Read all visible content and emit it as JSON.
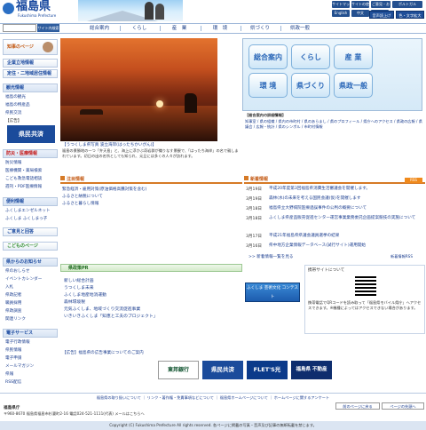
{
  "header": {
    "logo_text": "福島県",
    "logo_sub": "Fukushima Prefecture",
    "util_links": [
      "サイトマップ",
      "サイトの使い方",
      "ご意見・お問合せ",
      "English",
      "中文",
      "한국어",
      "ポルトガル"
    ],
    "accessibility": [
      "音声読上げ",
      "色・文字拡大"
    ]
  },
  "nav": {
    "search_placeholder": "",
    "search_button": "サイト内検索",
    "items": [
      "総合案内",
      "くらし",
      "産　業",
      "環　境",
      "県づくり",
      "県政一般"
    ]
  },
  "sidebar": {
    "governor_label": "知事のページ",
    "sections": [
      {
        "label": "企業立地情報"
      },
      {
        "label": "定住・二地域居住情報"
      }
    ],
    "tourism": {
      "title": "観光情報",
      "items": [
        "福島の観光",
        "福島の特産品",
        "県民交流"
      ]
    },
    "ad_label": "【広告】",
    "ad_banner": "県民共済",
    "disaster": {
      "title": "防災・医療情報",
      "items": [
        "防災情報",
        "医療機関・薬局検索",
        "こども救急電話相談",
        "週刊・PDF医療情報"
      ]
    },
    "useful": {
      "title": "便利情報",
      "items": [
        "ふくしまエンゼルネット",
        "ふくしま ふくしまっ子"
      ]
    },
    "opinion": "ご意見と回答",
    "kids": "こどものページ",
    "notice": {
      "title": "県からのお知らせ",
      "items": [
        "県のおしらせ",
        "イベントカレンダー",
        "入札",
        "県政記者",
        "職員採用",
        "県政調査",
        "関連リンク"
      ]
    },
    "eservice": {
      "title": "電子サービス",
      "items": [
        "電子行政情報",
        "県民情報",
        "電子申請",
        "メールマガジン",
        "県報",
        "RSS配信"
      ]
    }
  },
  "hero": {
    "caption": "【うつくしま県写真 波立海岸(はったちかいがん)】",
    "desc": "福島の景勝地の一つ「弁天島」と、海上に浮かぶ奇岩群が織りなす景観で、「はったち海岸」の名で親しまれています。初日の出の名所としても知られ、元旦には多くの人々が訪れます。"
  },
  "tiles": [
    "総合案内",
    "くらし",
    "産 業",
    "環 境",
    "県づくり",
    "県政一般"
  ],
  "links": {
    "title": "【総合案内の詳細情報】",
    "text": "知事室 / 県の組織 / 県内の市町村 / 県のあらまし / 県のプロフィール / 県庁へのアクセス / 県政の広報 / 県議会 / 広報・統計 / 県のシンボル / 市町村情報"
  },
  "notice": {
    "title": "注目情報",
    "items": [
      "緊急経済・雇用対策(原油価格高騰対策を含む)",
      "ふるさと納税について",
      "ふるさと暮らし情報"
    ]
  },
  "news": {
    "title": "新着情報",
    "rss": "RSS",
    "items": [
      {
        "date": "3月19日",
        "text": "平成20年度第3回福島県消費生活審議会を開催します。"
      },
      {
        "date": "3月19日",
        "text": "森林(水)の未来を考える国民会議(仮)を開催します"
      },
      {
        "date": "3月18日",
        "text": "福島県立大野病院医療過誤事件の公判の概要について"
      },
      {
        "date": "3月18日",
        "text": "ふくしま県産品販売促進センター運営事業業務委託企画提案競技の実施について"
      },
      {
        "date": "3月17日",
        "text": "平成21年福島県県議会議員選挙の結果"
      },
      {
        "date": "3月16日",
        "text": "県中地方企業情報データベース(試行サイト)運用開始"
      }
    ],
    "more": ">> 新着情報一覧を見る",
    "rss_label": "新着情報RSS"
  },
  "pr": {
    "title": "県政策PR",
    "items": [
      "新しい総合計画",
      "うつくしま未来",
      "ふくしま地産地消運動",
      "森林環境税",
      "元気ふくしま、地域づくり交流促進事業",
      "いきいきふくしま「知恵と工夫のプロジェクト」"
    ],
    "banner": "ふくしま 芸術文化 コンテスト"
  },
  "mobile": {
    "title": "携帯サイトについて",
    "desc": "携帯電話でQRコードを読み取って「福島県モバイル県庁」へアクセスできます。※機種によってはアクセスできない場合があります。"
  },
  "ads": {
    "label": "【広告】福島県の広告事業についてのご案内",
    "banners": [
      "東邦銀行",
      "県民共済",
      "FLET'S光",
      "福島県 不動産"
    ]
  },
  "footer": {
    "links": "福島県の取り扱いについて ｜ リンク・著作権・免責事項などについて ｜ 福島県ホームページについて ｜ ホームページに関するアンケート",
    "prev": "前のページに戻る",
    "top": "ページの先頭へ",
    "address_title": "福島県庁",
    "address": "〒960-8670 福島県福島市杉妻町2-16 電話024-521-1111(代表) メールはこちらへ",
    "copyright": "Copyright (C) Fukushima Prefecture All rights reserved. 各ページに掲載の写真・音声及び記事の無断転載を禁じます。"
  },
  "colors": {
    "brand": "#17479e",
    "accent": "#d67a26"
  }
}
